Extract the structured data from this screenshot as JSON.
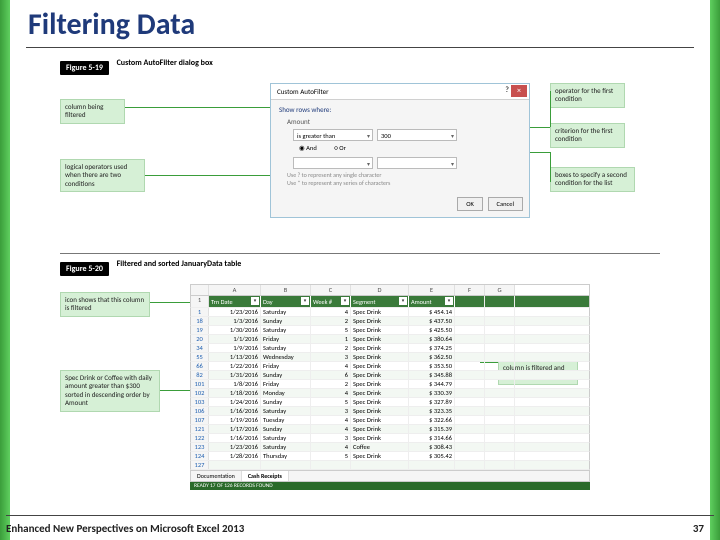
{
  "slide": {
    "title": "Filtering Data",
    "footer_left": "Enhanced New Perspectives on Microsoft Excel 2013",
    "page_number": "37"
  },
  "figure1": {
    "number": "Figure 5-19",
    "caption": "Custom AutoFilter dialog box",
    "callouts": {
      "column_filtered": "column being filtered",
      "logical_ops": "logical operators used when there are two conditions",
      "operator_first": "operator for the first condition",
      "criterion_first": "criterion for the first condition",
      "boxes_second": "boxes to specify a second condition for the list"
    },
    "dialog": {
      "title": "Custom AutoFilter",
      "help": "?",
      "close": "×",
      "show_rows": "Show rows where:",
      "field": "Amount",
      "operator1": "is greater than",
      "value1": "300",
      "and": "And",
      "or": "Or",
      "operator2": "",
      "value2": "",
      "hint1": "Use ? to represent any single character",
      "hint2": "Use * to represent any series of characters",
      "ok": "OK",
      "cancel": "Cancel"
    }
  },
  "figure2": {
    "number": "Figure 5-20",
    "caption": "Filtered and sorted JanuaryData table",
    "callouts": {
      "icon_filtered": "icon shows that this column is filtered",
      "filter_desc": "Spec Drink or Coffee with daily amount greater than $300 sorted in descending order by Amount",
      "icon_sorted": "icon shows that this column is filtered and sorted"
    },
    "headers": {
      "A": "Trn Date",
      "B": "Day",
      "C": "Week #",
      "D": "Segment",
      "E": "Amount"
    },
    "columns": [
      "A",
      "B",
      "C",
      "D",
      "E",
      "F",
      "G"
    ],
    "rows": [
      {
        "r": "1",
        "A": "1/23/2016",
        "B": "Saturday",
        "C": "4",
        "D": "Spec Drink",
        "E": "$  454.14"
      },
      {
        "r": "18",
        "A": "1/3/2016",
        "B": "Sunday",
        "C": "2",
        "D": "Spec Drink",
        "E": "$  437.50"
      },
      {
        "r": "19",
        "A": "1/30/2016",
        "B": "Saturday",
        "C": "5",
        "D": "Spec Drink",
        "E": "$  425.50"
      },
      {
        "r": "20",
        "A": "1/1/2016",
        "B": "Friday",
        "C": "1",
        "D": "Spec Drink",
        "E": "$  380.64"
      },
      {
        "r": "34",
        "A": "1/9/2016",
        "B": "Saturday",
        "C": "2",
        "D": "Spec Drink",
        "E": "$  374.25"
      },
      {
        "r": "55",
        "A": "1/13/2016",
        "B": "Wednesday",
        "C": "3",
        "D": "Spec Drink",
        "E": "$  362.50"
      },
      {
        "r": "66",
        "A": "1/22/2016",
        "B": "Friday",
        "C": "4",
        "D": "Spec Drink",
        "E": "$  353.50"
      },
      {
        "r": "82",
        "A": "1/31/2016",
        "B": "Sunday",
        "C": "6",
        "D": "Spec Drink",
        "E": "$  345.88"
      },
      {
        "r": "101",
        "A": "1/8/2016",
        "B": "Friday",
        "C": "2",
        "D": "Spec Drink",
        "E": "$  344.79"
      },
      {
        "r": "102",
        "A": "1/18/2016",
        "B": "Monday",
        "C": "4",
        "D": "Spec Drink",
        "E": "$  330.39"
      },
      {
        "r": "103",
        "A": "1/24/2016",
        "B": "Sunday",
        "C": "5",
        "D": "Spec Drink",
        "E": "$  327.89"
      },
      {
        "r": "106",
        "A": "1/16/2016",
        "B": "Saturday",
        "C": "3",
        "D": "Spec Drink",
        "E": "$  323.35"
      },
      {
        "r": "107",
        "A": "1/19/2016",
        "B": "Tuesday",
        "C": "4",
        "D": "Spec Drink",
        "E": "$  322.66"
      },
      {
        "r": "121",
        "A": "1/17/2016",
        "B": "Sunday",
        "C": "4",
        "D": "Spec Drink",
        "E": "$  315.39"
      },
      {
        "r": "122",
        "A": "1/16/2016",
        "B": "Saturday",
        "C": "3",
        "D": "Spec Drink",
        "E": "$  314.66"
      },
      {
        "r": "123",
        "A": "1/23/2016",
        "B": "Saturday",
        "C": "4",
        "D": "Coffee",
        "E": "$  308.43"
      },
      {
        "r": "124",
        "A": "1/28/2016",
        "B": "Thursday",
        "C": "5",
        "D": "Spec Drink",
        "E": "$  305.42"
      },
      {
        "r": "127",
        "A": "",
        "B": "",
        "C": "",
        "D": "",
        "E": ""
      }
    ],
    "tabs": {
      "doc": "Documentation",
      "sheet": "Cash Receipts"
    },
    "statusbar": "READY   17 OF 126 RECORDS FOUND"
  },
  "chart_data": {
    "type": "table",
    "title": "Filtered and sorted JanuaryData table",
    "columns": [
      "Trn Date",
      "Day",
      "Week #",
      "Segment",
      "Amount"
    ],
    "rows": [
      [
        "1/23/2016",
        "Saturday",
        4,
        "Spec Drink",
        454.14
      ],
      [
        "1/3/2016",
        "Sunday",
        2,
        "Spec Drink",
        437.5
      ],
      [
        "1/30/2016",
        "Saturday",
        5,
        "Spec Drink",
        425.5
      ],
      [
        "1/1/2016",
        "Friday",
        1,
        "Spec Drink",
        380.64
      ],
      [
        "1/9/2016",
        "Saturday",
        2,
        "Spec Drink",
        374.25
      ],
      [
        "1/13/2016",
        "Wednesday",
        3,
        "Spec Drink",
        362.5
      ],
      [
        "1/22/2016",
        "Friday",
        4,
        "Spec Drink",
        353.5
      ],
      [
        "1/31/2016",
        "Sunday",
        6,
        "Spec Drink",
        345.88
      ],
      [
        "1/8/2016",
        "Friday",
        2,
        "Spec Drink",
        344.79
      ],
      [
        "1/18/2016",
        "Monday",
        4,
        "Spec Drink",
        330.39
      ],
      [
        "1/24/2016",
        "Sunday",
        5,
        "Spec Drink",
        327.89
      ],
      [
        "1/16/2016",
        "Saturday",
        3,
        "Spec Drink",
        323.35
      ],
      [
        "1/19/2016",
        "Tuesday",
        4,
        "Spec Drink",
        322.66
      ],
      [
        "1/17/2016",
        "Sunday",
        4,
        "Spec Drink",
        315.39
      ],
      [
        "1/16/2016",
        "Saturday",
        3,
        "Spec Drink",
        314.66
      ],
      [
        "1/23/2016",
        "Saturday",
        4,
        "Coffee",
        308.43
      ],
      [
        "1/28/2016",
        "Thursday",
        5,
        "Spec Drink",
        305.42
      ]
    ]
  }
}
